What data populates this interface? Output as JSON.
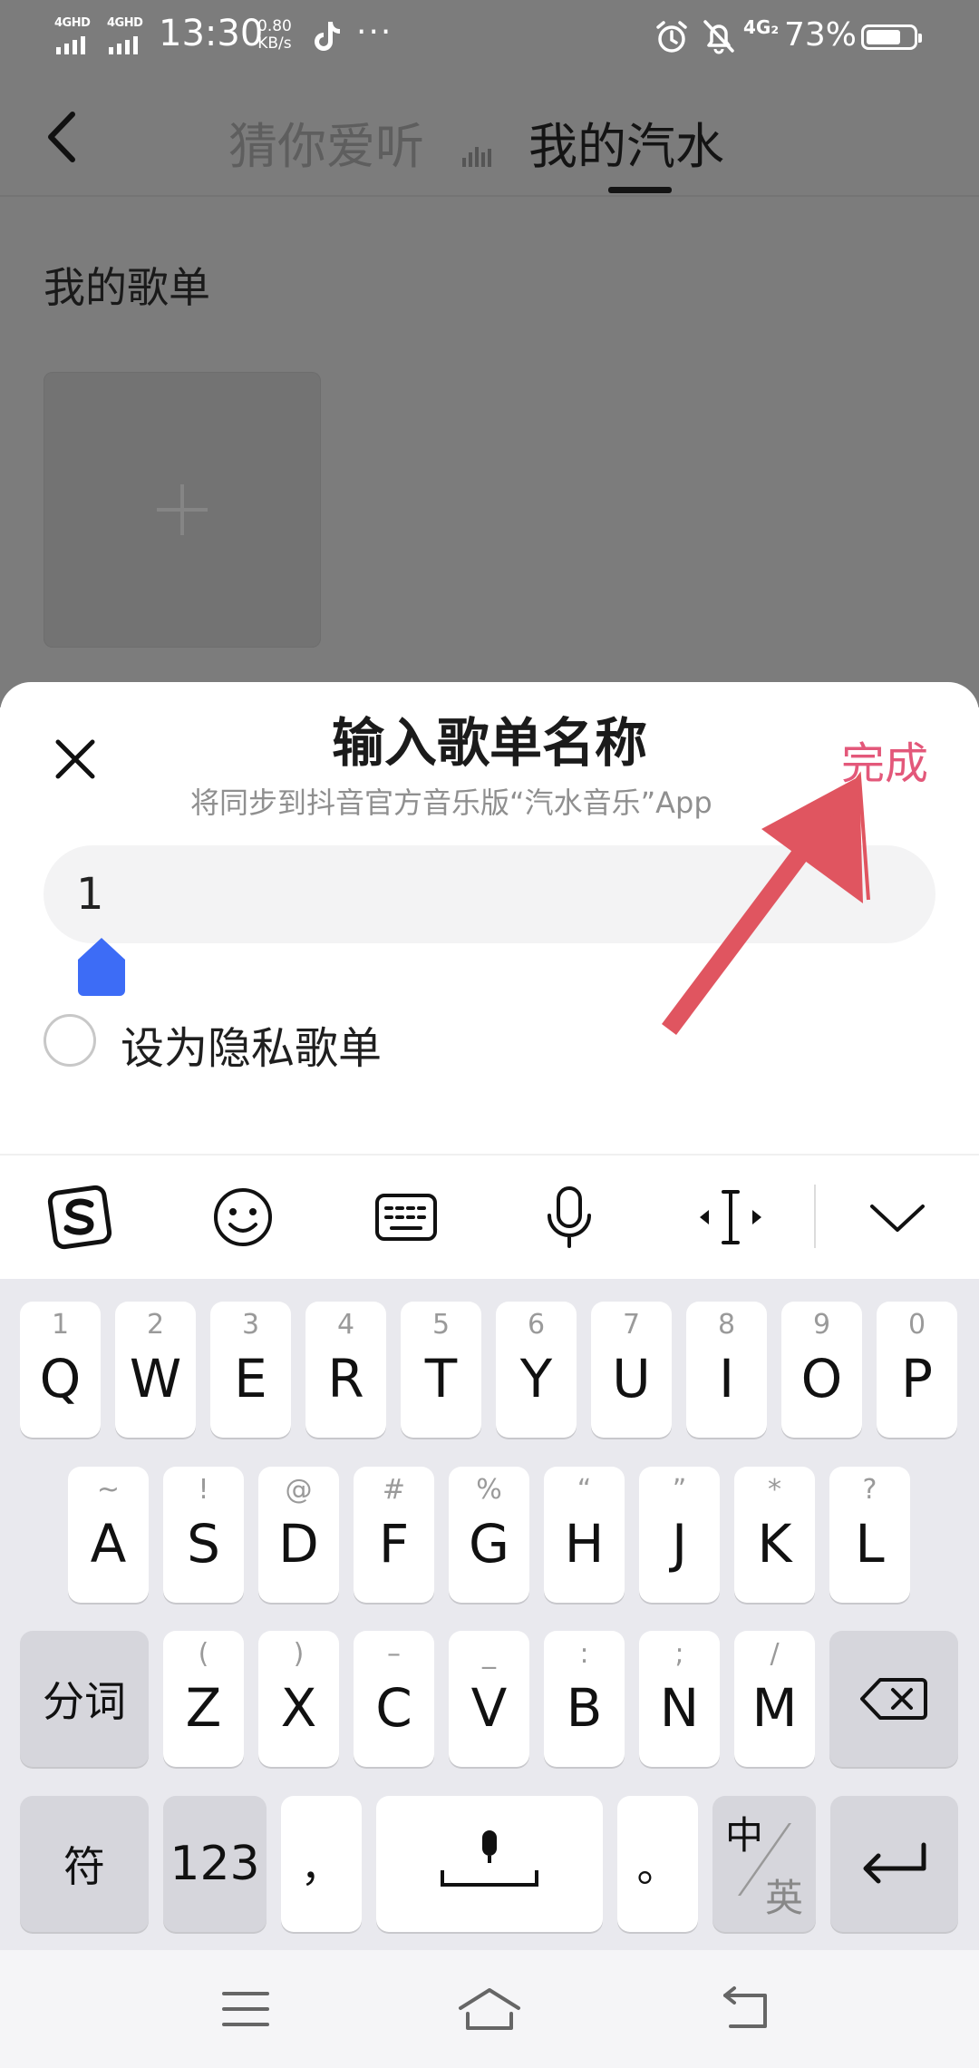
{
  "status_bar": {
    "sim1": "4GHD",
    "sim2": "4GHD",
    "time": "13:30",
    "net_speed_value": "0.80",
    "net_speed_unit": "KB/s",
    "more": "···",
    "lte": "4G₂",
    "battery_pct": "73%",
    "battery_level": 0.73
  },
  "header": {
    "tab_guess": "猜你爱听",
    "tab_mine": "我的汽水",
    "active_tab": "我的汽水"
  },
  "content": {
    "section_title": "我的歌单"
  },
  "sheet": {
    "title": "输入歌单名称",
    "subtitle": "将同步到抖音官方音乐版“汽水音乐”App",
    "done": "完成",
    "input_value": "1",
    "private_label": "设为隐私歌单"
  },
  "keyboard": {
    "row1": [
      {
        "hint": "1",
        "key": "Q"
      },
      {
        "hint": "2",
        "key": "W"
      },
      {
        "hint": "3",
        "key": "E"
      },
      {
        "hint": "4",
        "key": "R"
      },
      {
        "hint": "5",
        "key": "T"
      },
      {
        "hint": "6",
        "key": "Y"
      },
      {
        "hint": "7",
        "key": "U"
      },
      {
        "hint": "8",
        "key": "I"
      },
      {
        "hint": "9",
        "key": "O"
      },
      {
        "hint": "0",
        "key": "P"
      }
    ],
    "row2": [
      {
        "hint": "~",
        "key": "A"
      },
      {
        "hint": "!",
        "key": "S"
      },
      {
        "hint": "@",
        "key": "D"
      },
      {
        "hint": "#",
        "key": "F"
      },
      {
        "hint": "%",
        "key": "G"
      },
      {
        "hint": "“",
        "key": "H"
      },
      {
        "hint": "”",
        "key": "J"
      },
      {
        "hint": "*",
        "key": "K"
      },
      {
        "hint": "?",
        "key": "L"
      }
    ],
    "row3": [
      {
        "hint": "(",
        "key": "Z"
      },
      {
        "hint": ")",
        "key": "X"
      },
      {
        "hint": "–",
        "key": "C"
      },
      {
        "hint": "_",
        "key": "V"
      },
      {
        "hint": ":",
        "key": "B"
      },
      {
        "hint": ";",
        "key": "N"
      },
      {
        "hint": "/",
        "key": "M"
      }
    ],
    "split_word": "分词",
    "symbols": "符",
    "numbers": "123",
    "comma": "，",
    "period": "。",
    "lang_zh": "中",
    "lang_en": "英",
    "colors": {
      "accent": "#e3587a",
      "cursor": "#3d6cf6",
      "arrow": "#e05560"
    }
  }
}
